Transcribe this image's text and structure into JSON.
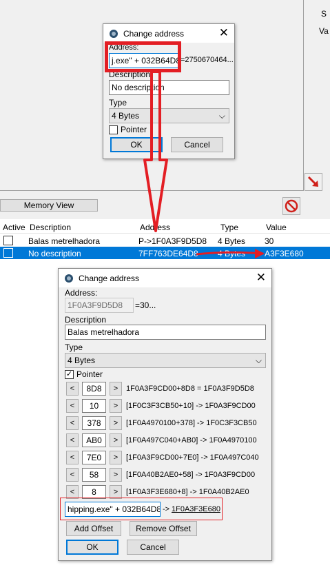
{
  "background": {
    "side_label_s": "S",
    "side_label_v": "Va",
    "memory_view_label": "Memory View",
    "table": {
      "headers": [
        "Active",
        "Description",
        "Address",
        "Type",
        "Value"
      ],
      "rows": [
        {
          "description": "Balas metrelhadora",
          "address": "P->1F0A3F9D5D8",
          "type": "4 Bytes",
          "value": "30"
        },
        {
          "description": "No description",
          "address": "7FF763DE64D8",
          "type": "4 Bytes",
          "value": "A3F3E680"
        }
      ]
    }
  },
  "dialog_small": {
    "title": "Change address",
    "address_label": "Address:",
    "address_value": "j.exe\" + 032B64D8",
    "address_result": "=2750670464...",
    "description_label": "Description",
    "description_value": "No description",
    "type_label": "Type",
    "type_value": "4 Bytes",
    "pointer_label": "Pointer",
    "ok_label": "OK",
    "cancel_label": "Cancel"
  },
  "dialog_large": {
    "title": "Change address",
    "address_label": "Address:",
    "address_value": "1F0A3F9D5D8",
    "address_result": "=30...",
    "description_label": "Description",
    "description_value": "Balas metrelhadora",
    "type_label": "Type",
    "type_value": "4 Bytes",
    "pointer_label": "Pointer",
    "offsets": [
      {
        "offset": "8D8",
        "text": "1F0A3F9CD00+8D8 = 1F0A3F9D5D8"
      },
      {
        "offset": "10",
        "text": "[1F0C3F3CB50+10] -> 1F0A3F9CD00"
      },
      {
        "offset": "378",
        "text": "[1F0A4970100+378] -> 1F0C3F3CB50"
      },
      {
        "offset": "AB0",
        "text": "[1F0A497C040+AB0] -> 1F0A4970100"
      },
      {
        "offset": "7E0",
        "text": "[1F0A3F9CD00+7E0] -> 1F0A497C040"
      },
      {
        "offset": "58",
        "text": "[1F0A40B2AE0+58] -> 1F0A3F9CD00"
      },
      {
        "offset": "8",
        "text": "[1F0A3F3E680+8] -> 1F0A40B2AE0"
      }
    ],
    "base_value": "hipping.exe\" + 032B64D8",
    "base_arrow": "->",
    "base_result": "1F0A3F3E680",
    "add_offset_label": "Add Offset",
    "remove_offset_label": "Remove Offset",
    "ok_label": "OK",
    "cancel_label": "Cancel",
    "dec_label": "<",
    "inc_label": ">"
  },
  "colors": {
    "selection": "#0078d7",
    "annotation_red": "#e31e24"
  }
}
